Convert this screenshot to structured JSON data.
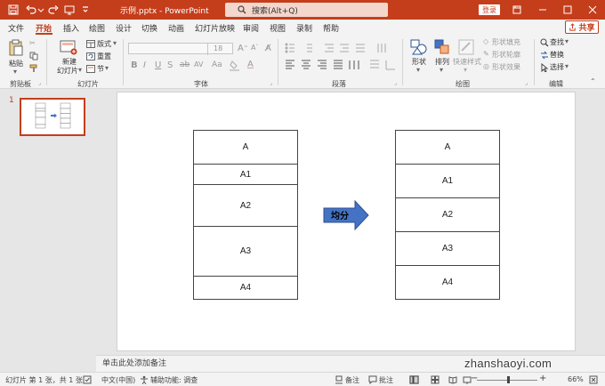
{
  "titlebar": {
    "doc_title": "示例.pptx - PowerPoint",
    "search_placeholder": "搜索(Alt+Q)",
    "login_label": "登录"
  },
  "tabs": [
    "文件",
    "开始",
    "插入",
    "绘图",
    "设计",
    "切换",
    "动画",
    "幻灯片放映",
    "审阅",
    "视图",
    "录制",
    "帮助"
  ],
  "active_tab": "开始",
  "share_label": "共享",
  "ribbon": {
    "clipboard": {
      "paste": "粘贴",
      "group": "剪贴板"
    },
    "slides": {
      "new_slide_1": "新建",
      "new_slide_2": "幻灯片",
      "layout": "版式",
      "reset": "重置",
      "section": "节",
      "group": "幻灯片"
    },
    "font": {
      "size": "18",
      "group": "字体"
    },
    "paragraph": {
      "group": "段落"
    },
    "drawing": {
      "shapes": "形状",
      "arrange": "排列",
      "quick_styles": "快速样式",
      "fill": "形状填充",
      "outline": "形状轮廓",
      "effects": "形状效果",
      "group": "绘图"
    },
    "editing": {
      "find": "查找",
      "replace": "替换",
      "select": "选择",
      "group": "编辑"
    }
  },
  "thumbnail": {
    "number": "1"
  },
  "slide": {
    "left_table": [
      "A",
      "A1",
      "A2",
      "A3",
      "A4"
    ],
    "right_table": [
      "A",
      "A1",
      "A2",
      "A3",
      "A4"
    ],
    "arrow_label": "均分",
    "arrow_color": "#4472c4"
  },
  "notes_placeholder": "单击此处添加备注",
  "status": {
    "slide_info": "幻灯片 第 1 张，共 1 张",
    "language": "中文(中国)",
    "accessibility": "辅助功能: 调查",
    "notes": "备注",
    "comments": "批注",
    "zoom": "66%"
  },
  "watermark": "zhanshaoyi.com",
  "colors": {
    "accent": "#c43e1c"
  }
}
